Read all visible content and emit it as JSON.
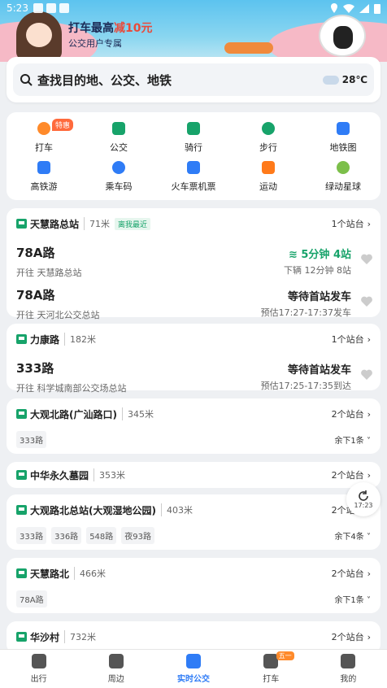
{
  "status": {
    "time": "5:23"
  },
  "banner": {
    "promo_pre": "打车最高",
    "promo_em": "减10元",
    "promo_sub": "公交用户专属"
  },
  "search": {
    "placeholder": "查找目的地、公交、地铁",
    "temperature": "28℃"
  },
  "services": [
    {
      "label": "打车",
      "icon": "taxi-icon",
      "badge": "特惠",
      "color": "#ff8a2a"
    },
    {
      "label": "公交",
      "icon": "bus-icon",
      "color": "#17a36a"
    },
    {
      "label": "骑行",
      "icon": "bike-icon",
      "color": "#17a36a"
    },
    {
      "label": "步行",
      "icon": "walk-icon",
      "color": "#17a36a"
    },
    {
      "label": "地铁图",
      "icon": "subway-icon",
      "color": "#2f7cf6"
    },
    {
      "label": "高铁游",
      "icon": "train-trip-icon",
      "color": "#2f7cf6"
    },
    {
      "label": "乘车码",
      "icon": "qr-code-icon",
      "color": "#2f7cf6"
    },
    {
      "label": "火车票机票",
      "icon": "ticket-icon",
      "color": "#2f7cf6"
    },
    {
      "label": "运动",
      "icon": "flame-icon",
      "color": "#ff7a1a"
    },
    {
      "label": "绿动星球",
      "icon": "planet-icon",
      "color": "#7cbf4a"
    }
  ],
  "stations": [
    {
      "name": "天慧路总站",
      "dist": "71米",
      "tag": "离我最近",
      "stops": "1个站台",
      "routes": [
        {
          "no": "78A路",
          "dir": "开往 天慧路总站",
          "status": "5分钟 4站",
          "sub": "下辆 12分钟 8站",
          "live": true
        },
        {
          "no": "78A路",
          "dir": "开往 天河北公交总站",
          "status": "等待首站发车",
          "sub": "预估17:27-17:37发车"
        }
      ]
    },
    {
      "name": "力康路",
      "dist": "182米",
      "stops": "1个站台",
      "routes": [
        {
          "no": "333路",
          "dir": "开往 科学城南部公交场总站",
          "status": "等待首站发车",
          "sub": "预估17:25-17:35到达"
        }
      ]
    },
    {
      "name": "大观北路(广汕路口)",
      "dist": "345米",
      "stops": "2个站台",
      "chips": [
        "333路"
      ],
      "more": "余下1条"
    },
    {
      "name": "中华永久墓园",
      "dist": "353米",
      "stops": "2个站台"
    },
    {
      "name": "大观路北总站(大观湿地公园)",
      "dist": "403米",
      "stops": "2个站台",
      "chips": [
        "333路",
        "336路",
        "548路",
        "夜93路"
      ],
      "more": "余下4条"
    },
    {
      "name": "天慧路北",
      "dist": "466米",
      "stops": "2个站台",
      "chips": [
        "78A路"
      ],
      "more": "余下1条"
    },
    {
      "name": "华沙村",
      "dist": "732米",
      "stops": "2个站台"
    }
  ],
  "refresh": {
    "time": "17:23"
  },
  "tabs": [
    {
      "label": "出行",
      "icon": "travel-icon"
    },
    {
      "label": "周边",
      "icon": "nearby-icon"
    },
    {
      "label": "实时公交",
      "icon": "realtime-bus-icon",
      "active": true
    },
    {
      "label": "打车",
      "icon": "taxi-tab-icon",
      "badge": "五一"
    },
    {
      "label": "我的",
      "icon": "profile-icon"
    }
  ]
}
